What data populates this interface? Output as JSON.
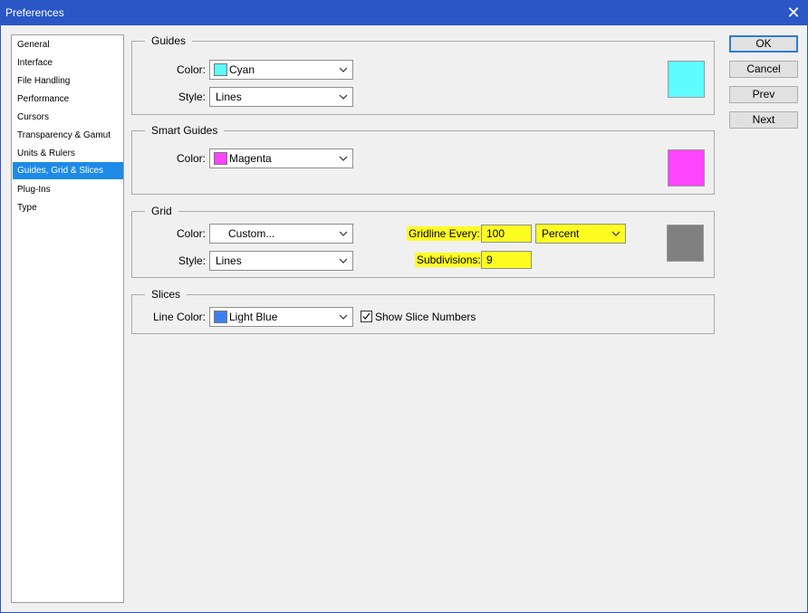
{
  "window": {
    "title": "Preferences"
  },
  "nav": {
    "items": [
      {
        "label": "General"
      },
      {
        "label": "Interface"
      },
      {
        "label": "File Handling"
      },
      {
        "label": "Performance"
      },
      {
        "label": "Cursors"
      },
      {
        "label": "Transparency & Gamut"
      },
      {
        "label": "Units & Rulers"
      },
      {
        "label": "Guides, Grid & Slices",
        "selected": true
      },
      {
        "label": "Plug-Ins"
      },
      {
        "label": "Type"
      }
    ]
  },
  "guides": {
    "title": "Guides",
    "color_label": "Color:",
    "color_value": "Cyan",
    "color_hex": "#5ffcff",
    "style_label": "Style:",
    "style_value": "Lines"
  },
  "smart_guides": {
    "title": "Smart Guides",
    "color_label": "Color:",
    "color_value": "Magenta",
    "color_hex": "#ff45ff"
  },
  "grid": {
    "title": "Grid",
    "color_label": "Color:",
    "color_value": "Custom...",
    "color_hex": "#808080",
    "style_label": "Style:",
    "style_value": "Lines",
    "gridline_label": "Gridline Every:",
    "gridline_value": "100",
    "gridline_unit": "Percent",
    "subdivisions_label": "Subdivisions:",
    "subdivisions_value": "9"
  },
  "slices": {
    "title": "Slices",
    "line_color_label": "Line Color:",
    "line_color_value": "Light Blue",
    "line_color_hex": "#3e7ff0",
    "show_numbers_label": "Show Slice Numbers",
    "show_numbers_checked": true
  },
  "buttons": {
    "ok": "OK",
    "cancel": "Cancel",
    "prev": "Prev",
    "next": "Next"
  },
  "colors": {
    "titlebar": "#2b56c5",
    "selection": "#1e8ae7",
    "highlight": "#fffc21"
  }
}
